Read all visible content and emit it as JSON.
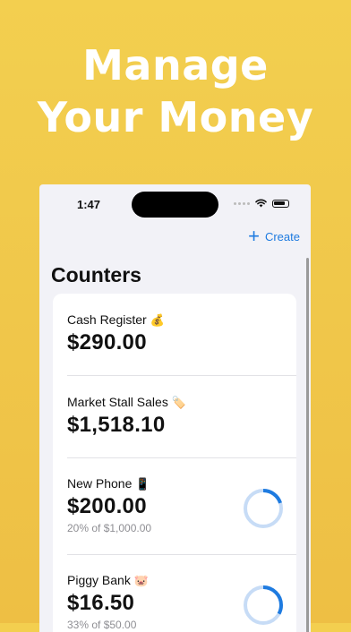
{
  "promo": {
    "line1": "Manage",
    "line2": "Your Money"
  },
  "status_bar": {
    "time": "1:47"
  },
  "nav": {
    "create_label": "Create",
    "plus": "+"
  },
  "page": {
    "title": "Counters"
  },
  "counters": [
    {
      "name": "Cash Register",
      "emoji": "💰",
      "amount": "$290.00"
    },
    {
      "name": "Market Stall Sales",
      "emoji": "🏷️",
      "amount": "$1,518.10"
    },
    {
      "name": "New Phone",
      "emoji": "📱",
      "amount": "$200.00",
      "goal_text": "20% of $1,000.00",
      "progress": 0.2
    },
    {
      "name": "Piggy Bank",
      "emoji": "🐷",
      "amount": "$16.50",
      "goal_text": "33% of $50.00",
      "progress": 0.33
    }
  ],
  "colors": {
    "accent": "#1e7be0",
    "background": "#f0c74a",
    "ring_track": "#c7dcf6",
    "ring_fill": "#1e7be0"
  }
}
